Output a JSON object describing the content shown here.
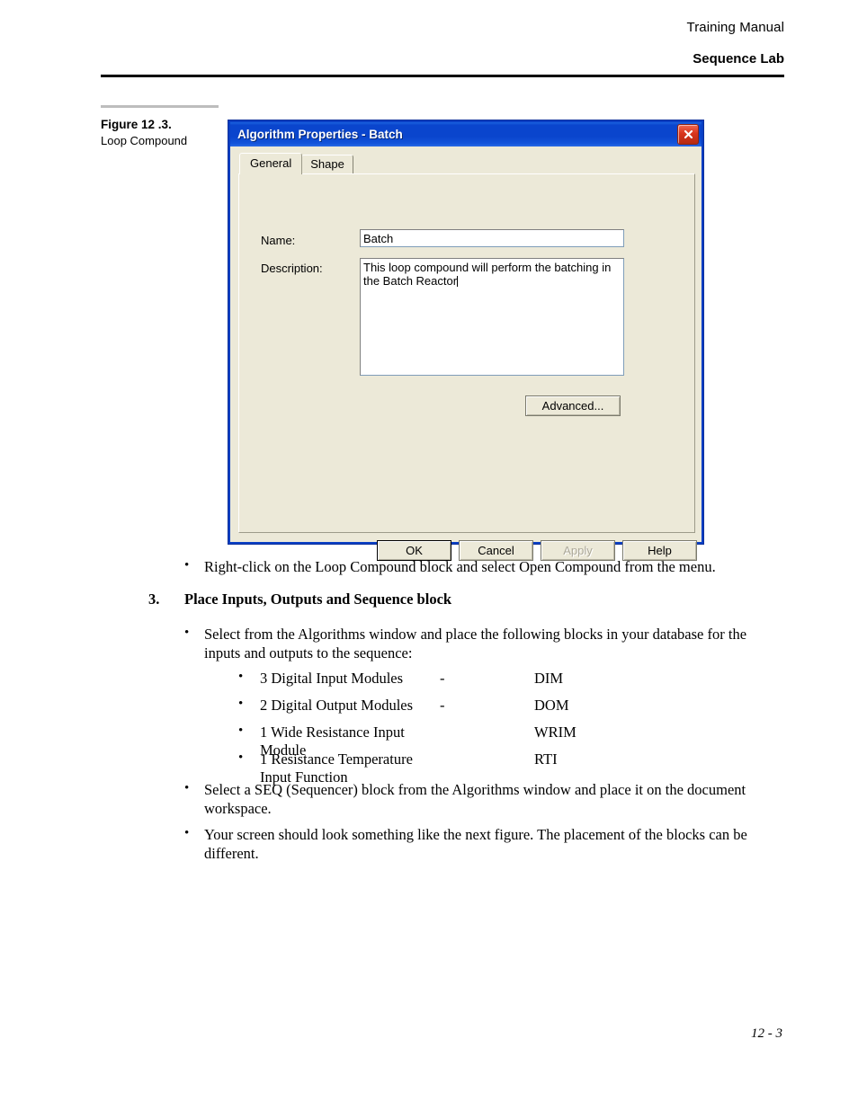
{
  "header": {
    "manual": "Training Manual",
    "section": "Sequence Lab"
  },
  "figure_caption": {
    "title": "Figure 12 .3.",
    "subtitle": "Loop Compound"
  },
  "dialog": {
    "title": "Algorithm Properties - Batch",
    "close_icon": "close-icon",
    "tabs": [
      {
        "label": "General",
        "active": true
      },
      {
        "label": "Shape",
        "active": false
      }
    ],
    "fields": {
      "name_label": "Name:",
      "name_value": "Batch",
      "description_label": "Description:",
      "description_value": "This loop compound will perform the batching in the Batch Reactor"
    },
    "buttons": {
      "advanced": "Advanced...",
      "ok": "OK",
      "cancel": "Cancel",
      "apply": "Apply",
      "help": "Help"
    },
    "colors": {
      "titlebar": "#0a45cd",
      "face": "#ece9d8",
      "close_button": "#d8341c"
    }
  },
  "body": {
    "bullet_char": "•",
    "bullet_1": "Right-click on the Loop Compound block and select Open Compound from the menu.",
    "step_number": "3.",
    "step_title": "Place Inputs, Outputs and Sequence block",
    "bullet_2": "Select from the Algorithms window and place the following blocks in your database for the inputs and outputs to the sequence:",
    "modules": [
      {
        "name": "3 Digital Input Modules",
        "dash": "-",
        "abbr": "DIM"
      },
      {
        "name": "2 Digital Output Modules",
        "dash": "-",
        "abbr": "DOM"
      },
      {
        "name": "1 Wide Resistance Input Module",
        "dash": "",
        "abbr": "WRIM"
      },
      {
        "name": "1 Resistance Temperature Input Function",
        "dash": "",
        "abbr": "RTI"
      }
    ],
    "bullet_3": "Select a SEQ (Sequencer) block from the Algorithms window and place it on the document workspace.",
    "bullet_4": "Your screen should look something like the next figure. The placement of the blocks can be different."
  },
  "footer": {
    "page_number": "12 - 3"
  }
}
